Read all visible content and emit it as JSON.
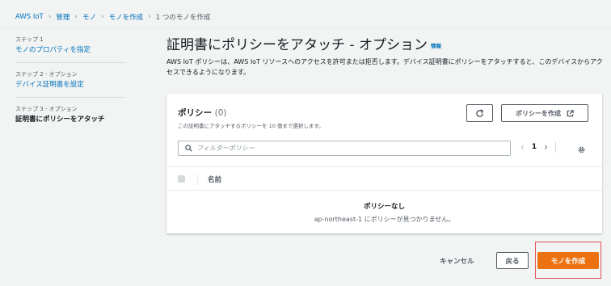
{
  "breadcrumb": {
    "items": [
      "AWS IoT",
      "管理",
      "モノ",
      "モノを作成"
    ],
    "current": "1 つのモノを作成"
  },
  "steps": [
    {
      "label": "ステップ 1",
      "title": "モノのプロパティを指定"
    },
    {
      "label": "ステップ 2 - オプション",
      "title": "デバイス証明書を設定"
    },
    {
      "label": "ステップ 3 - オプション",
      "title": "証明書にポリシーをアタッチ"
    }
  ],
  "page": {
    "title": "証明書にポリシーをアタッチ - オプション",
    "info": "情報",
    "description": "AWS IoT ポリシーは、AWS IoT リソースへのアクセスを許可または拒否します。デバイス証明書にポリシーをアタッチすると、このデバイスからアクセスできるようになります。"
  },
  "policies": {
    "title": "ポリシー",
    "count": "(0)",
    "description": "この証明書にアタッチするポリシーを 10 個まで選択します。",
    "create_button": "ポリシーを作成",
    "filter_placeholder": "フィルターポリシー",
    "page_number": "1",
    "column_name": "名前",
    "empty_title": "ポリシーなし",
    "empty_description": "ap-northeast-1 にポリシーが見つかりません。"
  },
  "footer": {
    "cancel": "キャンセル",
    "back": "戻る",
    "create": "モノを作成"
  },
  "colors": {
    "link": "#0073bb",
    "primary": "#ec7211",
    "highlight": "#e0535e"
  }
}
